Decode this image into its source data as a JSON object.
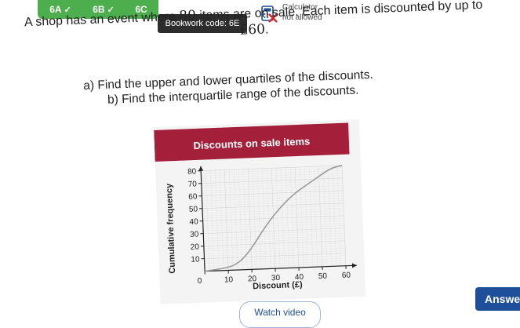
{
  "tabs": [
    {
      "label": "6A",
      "check": "✓"
    },
    {
      "label": "6B",
      "check": "✓"
    },
    {
      "label": "6C",
      "check": ""
    }
  ],
  "bookwork": "Bookwork code: 6E",
  "calculator": {
    "line1": "Calculator",
    "line2": "not allowed",
    "icon": "calculator-crossed-icon"
  },
  "question": {
    "pre": "A shop has an event where ",
    "num1": "80",
    "mid": " items are on sale. Each item is discounted by up to ",
    "num2": "£60",
    "post": "."
  },
  "parts": {
    "a": "a) Find the upper and lower quartiles of the discounts.",
    "b": "b) Find the interquartile range of the discounts."
  },
  "chart_data": {
    "type": "line",
    "title": "Discounts on sale items",
    "xlabel": "Discount (£)",
    "ylabel": "Cumulative frequency",
    "xlim": [
      0,
      60
    ],
    "ylim": [
      0,
      80
    ],
    "xticks": [
      "0",
      "10",
      "20",
      "30",
      "40",
      "50",
      "60"
    ],
    "yticks": [
      "10",
      "20",
      "30",
      "40",
      "50",
      "60",
      "70",
      "80"
    ],
    "grid": true,
    "series": [
      {
        "points": [
          [
            0,
            0
          ],
          [
            10,
            2
          ],
          [
            15,
            6
          ],
          [
            20,
            16
          ],
          [
            25,
            30
          ],
          [
            30,
            42
          ],
          [
            35,
            52
          ],
          [
            40,
            60
          ],
          [
            45,
            66
          ],
          [
            50,
            72
          ],
          [
            55,
            78
          ],
          [
            60,
            80
          ]
        ]
      }
    ],
    "title_bg": "#a31f3a",
    "line_color": "#9a9a9a"
  },
  "buttons": {
    "answer": "Answer",
    "watch": "Watch video"
  }
}
